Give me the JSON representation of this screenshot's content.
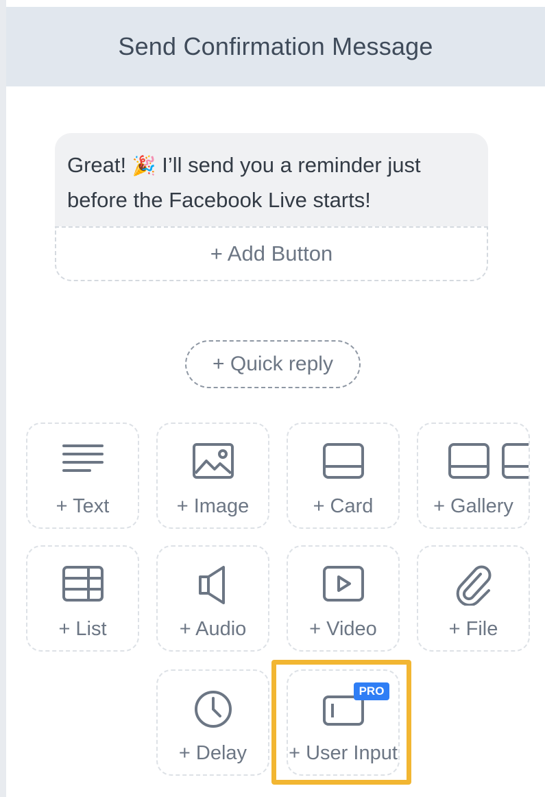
{
  "header": {
    "title": "Send Confirmation Message"
  },
  "message": {
    "text_before": "Great! ",
    "emoji": "🎉",
    "text_after": " I’ll send you a reminder just before the Facebook Live starts!",
    "add_button_label": "+ Add Button"
  },
  "quick_reply_label": "+ Quick reply",
  "tiles": [
    {
      "label": "+ Text",
      "icon": "text-lines-icon"
    },
    {
      "label": "+ Image",
      "icon": "image-icon"
    },
    {
      "label": "+ Card",
      "icon": "card-icon"
    },
    {
      "label": "+ Gallery",
      "icon": "gallery-icon"
    },
    {
      "label": "+ List",
      "icon": "list-icon"
    },
    {
      "label": "+ Audio",
      "icon": "speaker-icon"
    },
    {
      "label": "+ Video",
      "icon": "video-play-icon"
    },
    {
      "label": "+ File",
      "icon": "paperclip-icon"
    },
    {
      "label": "+ Delay",
      "icon": "clock-icon"
    },
    {
      "label": "+ User Input",
      "icon": "input-field-icon",
      "badge": "PRO",
      "highlighted": true
    }
  ],
  "colors": {
    "accent_highlight": "#f2b632",
    "pro_badge": "#2f7ef5",
    "header_bg": "#e1e7ee"
  }
}
